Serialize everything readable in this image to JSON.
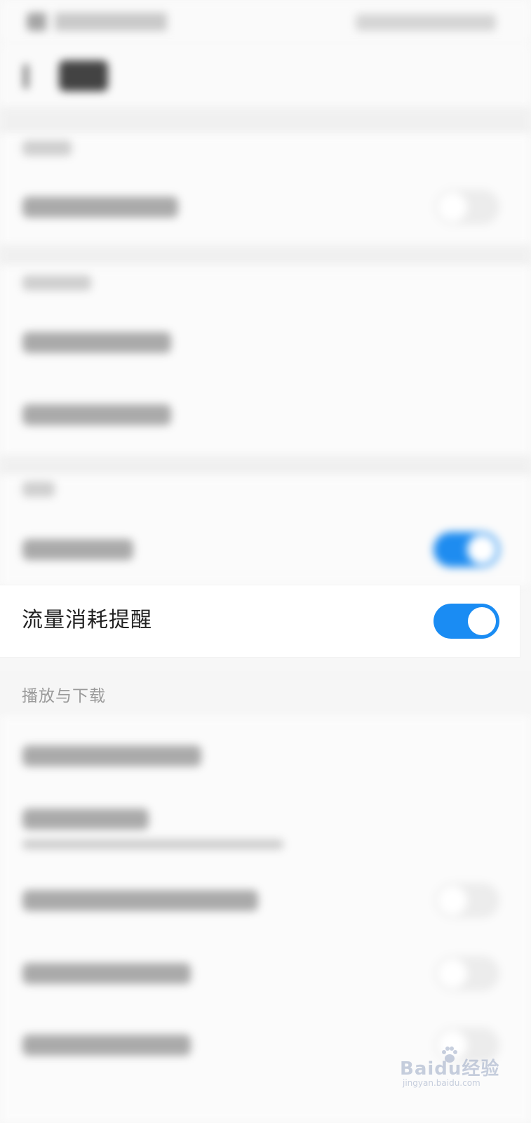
{
  "settings": {
    "data_usage_reminder": {
      "label": "流量消耗提醒",
      "enabled": true
    },
    "playback_section": {
      "header": "播放与下载"
    }
  },
  "watermark": {
    "brand": "Baidu经验",
    "url": "jingyan.baidu.com"
  },
  "colors": {
    "accent": "#1a8cf3",
    "background": "#f7f7f7",
    "row_background": "#ffffff",
    "header_text": "#9a9a9a"
  }
}
